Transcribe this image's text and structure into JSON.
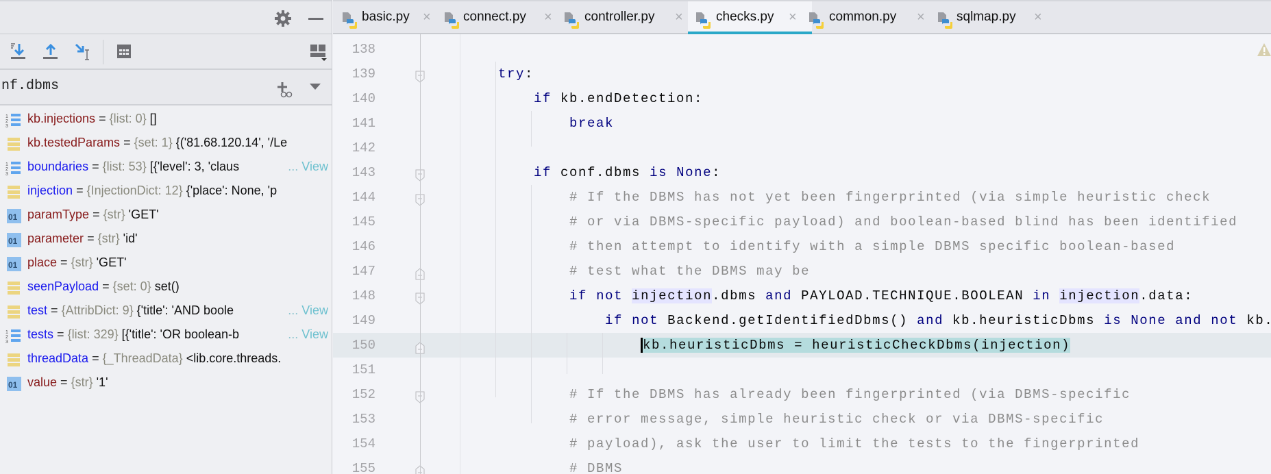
{
  "debugger": {
    "watch_expression": "nf.dbms",
    "variables": [
      {
        "name": "kb.injections",
        "type": "{list: 0}",
        "value": "[]",
        "icon": "list",
        "color": "maroon"
      },
      {
        "name": "kb.testedParams",
        "type": "{set: 1}",
        "value": "{('81.68.120.14', '/Le",
        "icon": "set",
        "color": "maroon"
      },
      {
        "name": "boundaries",
        "type": "{list: 53}",
        "value": "[{'level': 3, 'claus",
        "icon": "list",
        "color": "blue",
        "more": "...",
        "view": "View"
      },
      {
        "name": "injection",
        "type": "{InjectionDict: 12}",
        "value": "{'place': None, 'p",
        "icon": "set",
        "color": "blue"
      },
      {
        "name": "paramType",
        "type": "{str}",
        "value": "'GET'",
        "icon": "str",
        "color": "maroon"
      },
      {
        "name": "parameter",
        "type": "{str}",
        "value": "'id'",
        "icon": "str",
        "color": "maroon"
      },
      {
        "name": "place",
        "type": "{str}",
        "value": "'GET'",
        "icon": "str",
        "color": "maroon"
      },
      {
        "name": "seenPayload",
        "type": "{set: 0}",
        "value": "set()",
        "icon": "set",
        "color": "blue"
      },
      {
        "name": "test",
        "type": "{AttribDict: 9}",
        "value": "{'title': 'AND boole",
        "icon": "set",
        "color": "blue",
        "more": "...",
        "view": "View"
      },
      {
        "name": "tests",
        "type": "{list: 329}",
        "value": "[{'title': 'OR boolean-b",
        "icon": "list",
        "color": "blue",
        "more": "...",
        "view": "View"
      },
      {
        "name": "threadData",
        "type": "{_ThreadData}",
        "value": "<lib.core.threads.",
        "icon": "set",
        "color": "blue"
      },
      {
        "name": "value",
        "type": "{str}",
        "value": "'1'",
        "icon": "str",
        "color": "maroon"
      }
    ],
    "equals": "="
  },
  "tabs": [
    {
      "label": "basic.py",
      "active": false
    },
    {
      "label": "connect.py",
      "active": false
    },
    {
      "label": "controller.py",
      "active": false
    },
    {
      "label": "checks.py",
      "active": true
    },
    {
      "label": "common.py",
      "active": false
    },
    {
      "label": "sqlmap.py",
      "active": false
    }
  ],
  "tab_close": "×",
  "colors": {
    "accent": "#2aa8c8",
    "selection": "#b5dcde",
    "keyword": "#00007f",
    "comment": "#8c8c8c"
  },
  "editor": {
    "current_line": "150",
    "lines": [
      {
        "num": "138",
        "indent": "",
        "tokens": []
      },
      {
        "num": "139",
        "indent": "    ",
        "fold": "start",
        "tokens": [
          {
            "t": "try",
            "k": "k"
          },
          {
            "t": ":",
            "k": "n"
          }
        ]
      },
      {
        "num": "140",
        "indent": "        ",
        "tokens": [
          {
            "t": "if",
            "k": "k"
          },
          {
            "t": " kb.endDetection:",
            "k": "n"
          }
        ]
      },
      {
        "num": "141",
        "indent": "            ",
        "tokens": [
          {
            "t": "break",
            "k": "k"
          }
        ]
      },
      {
        "num": "142",
        "indent": "",
        "tokens": []
      },
      {
        "num": "143",
        "indent": "        ",
        "fold": "start",
        "tokens": [
          {
            "t": "if",
            "k": "k"
          },
          {
            "t": " conf.dbms ",
            "k": "n"
          },
          {
            "t": "is",
            "k": "k"
          },
          {
            "t": " ",
            "k": "n"
          },
          {
            "t": "None",
            "k": "k"
          },
          {
            "t": ":",
            "k": "n"
          }
        ]
      },
      {
        "num": "144",
        "indent": "            ",
        "fold": "start",
        "tokens": [
          {
            "t": "# If the DBMS has not yet been fingerprinted (via simple heuristic check",
            "k": "c"
          }
        ]
      },
      {
        "num": "145",
        "indent": "            ",
        "tokens": [
          {
            "t": "# or via DBMS-specific payload) and boolean-based blind has been identified",
            "k": "c"
          }
        ]
      },
      {
        "num": "146",
        "indent": "            ",
        "tokens": [
          {
            "t": "# then attempt to identify with a simple DBMS specific boolean-based",
            "k": "c"
          }
        ]
      },
      {
        "num": "147",
        "indent": "            ",
        "fold": "end",
        "tokens": [
          {
            "t": "# test what the DBMS may be",
            "k": "c"
          }
        ]
      },
      {
        "num": "148",
        "indent": "            ",
        "fold": "start",
        "tokens": [
          {
            "t": "if",
            "k": "k"
          },
          {
            "t": " ",
            "k": "n"
          },
          {
            "t": "not",
            "k": "k"
          },
          {
            "t": " ",
            "k": "n"
          },
          {
            "t": "injection",
            "k": "u"
          },
          {
            "t": ".dbms ",
            "k": "n"
          },
          {
            "t": "and",
            "k": "k"
          },
          {
            "t": " PAYLOAD.TECHNIQUE.BOOLEAN ",
            "k": "n"
          },
          {
            "t": "in",
            "k": "k"
          },
          {
            "t": " ",
            "k": "n"
          },
          {
            "t": "injection",
            "k": "u"
          },
          {
            "t": ".data:",
            "k": "n"
          }
        ]
      },
      {
        "num": "149",
        "indent": "                ",
        "tokens": [
          {
            "t": "if",
            "k": "k"
          },
          {
            "t": " ",
            "k": "n"
          },
          {
            "t": "not",
            "k": "k"
          },
          {
            "t": " Backend.getIdentifiedDbms() ",
            "k": "n"
          },
          {
            "t": "and",
            "k": "k"
          },
          {
            "t": " kb.heuristicDbms ",
            "k": "n"
          },
          {
            "t": "is",
            "k": "k"
          },
          {
            "t": " ",
            "k": "n"
          },
          {
            "t": "None",
            "k": "k"
          },
          {
            "t": " ",
            "k": "n"
          },
          {
            "t": "and",
            "k": "k"
          },
          {
            "t": " ",
            "k": "n"
          },
          {
            "t": "not",
            "k": "k"
          },
          {
            "t": " kb.",
            "k": "n"
          }
        ]
      },
      {
        "num": "150",
        "indent": "                    ",
        "fold": "end",
        "tokens": [
          {
            "t": "kb.heuristicDbms = heuristicCheckDbms(injection)",
            "k": "s"
          }
        ]
      },
      {
        "num": "151",
        "indent": "",
        "tokens": []
      },
      {
        "num": "152",
        "indent": "            ",
        "fold": "start",
        "tokens": [
          {
            "t": "# If the DBMS has already been fingerprinted (via DBMS-specific",
            "k": "c"
          }
        ]
      },
      {
        "num": "153",
        "indent": "            ",
        "tokens": [
          {
            "t": "# error message, simple heuristic check or via DBMS-specific",
            "k": "c"
          }
        ]
      },
      {
        "num": "154",
        "indent": "            ",
        "tokens": [
          {
            "t": "# payload), ask the user to limit the tests to the fingerprinted",
            "k": "c"
          }
        ]
      },
      {
        "num": "155",
        "indent": "            ",
        "fold": "end",
        "tokens": [
          {
            "t": "# DBMS",
            "k": "c"
          }
        ]
      }
    ]
  }
}
